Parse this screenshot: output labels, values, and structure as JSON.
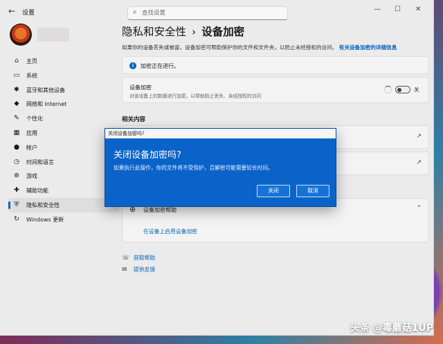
{
  "window": {
    "app_title": "设置",
    "search_placeholder": "查找设置",
    "back_glyph": "←",
    "controls": {
      "minimize": "—",
      "maximize": "☐",
      "close": "✕"
    }
  },
  "sidebar": {
    "items": [
      {
        "label": "主页",
        "icon": "⌂"
      },
      {
        "label": "系统",
        "icon": "▭"
      },
      {
        "label": "蓝牙和其他设备",
        "icon": "✱"
      },
      {
        "label": "网络和 Internet",
        "icon": "◆"
      },
      {
        "label": "个性化",
        "icon": "✎"
      },
      {
        "label": "应用",
        "icon": "▦"
      },
      {
        "label": "帐户",
        "icon": "●"
      },
      {
        "label": "时间和语言",
        "icon": "◷"
      },
      {
        "label": "游戏",
        "icon": "⊛"
      },
      {
        "label": "辅助功能",
        "icon": "✚"
      },
      {
        "label": "隐私和安全性",
        "icon": "⛨",
        "active": true
      },
      {
        "label": "Windows 更新",
        "icon": "↻"
      }
    ]
  },
  "main": {
    "breadcrumb": {
      "parent": "隐私和安全性",
      "separator": "›",
      "current": "设备加密"
    },
    "description": "如果你的设备丢失或被盗，设备加密可帮助保护你的文件和文件夹，以防止未经授权的访问。",
    "description_link": "有关设备加密的详细信息",
    "info_banner": "加密正在进行。",
    "device_encryption": {
      "title": "设备加密",
      "subtitle": "对该设备上的数据进行加密，以帮助防止丢失、未经授权的访问",
      "toggle_label": "关",
      "toggle_on": false
    },
    "related_heading": "相关内容",
    "help": {
      "title": "设备加密帮助",
      "link": "在设备上启用设备加密"
    },
    "get_help": "获取帮助",
    "feedback": "提供反馈"
  },
  "dialog": {
    "window_title": "关闭设备加密吗?",
    "heading": "关闭设备加密吗?",
    "body": "如果执行此操作，你的文件将不受保护，且解密可能需要较长时间。",
    "confirm_label": "关闭",
    "cancel_label": "取消"
  },
  "watermark": "头条 @毒蘑菇1UP",
  "colors": {
    "accent": "#0067c0",
    "dialog_bg": "#0a63c9"
  }
}
